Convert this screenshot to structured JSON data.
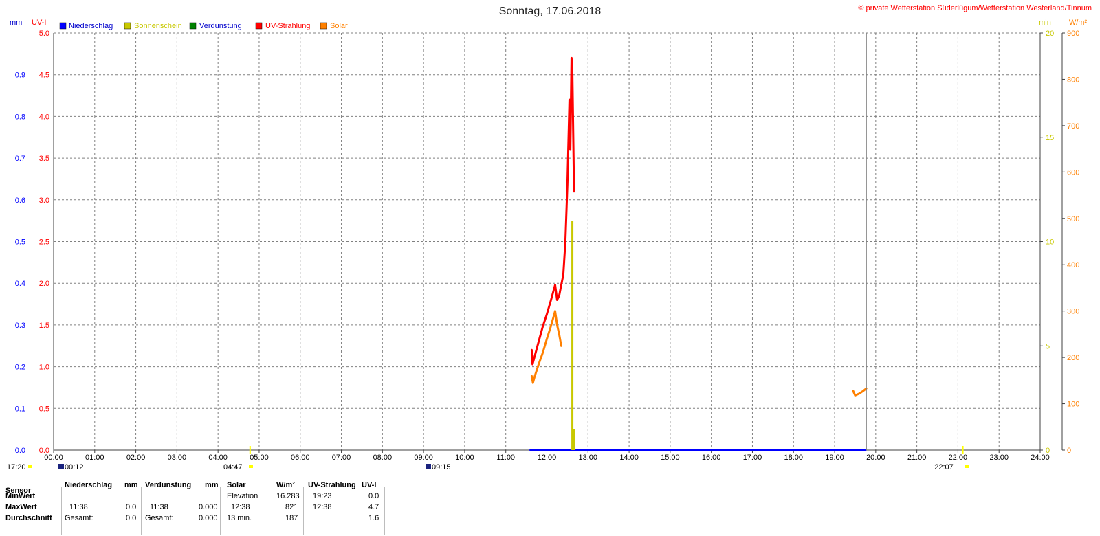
{
  "title": "Sonntag, 17.06.2018",
  "copyright": "© private Wetterstation Süderlügum/Wetterstation Westerland/Tinnum",
  "unit_labels": {
    "mm": "mm",
    "uvi": "UV-I",
    "min": "min",
    "wm2": "W/m²"
  },
  "colors": {
    "niederschlag": "#0000ff",
    "sonnenschein": "#c8c800",
    "verdunstung": "#008000",
    "uv": "#ff0000",
    "solar": "#ff8000",
    "grid": "#808080"
  },
  "sun_markers": {
    "left": [
      "17:20",
      "00:12",
      "04:47",
      "09:15"
    ],
    "right": "22:07"
  },
  "chart_data": {
    "type": "line",
    "legend_placement": "top-left",
    "grid": true,
    "x_axis": {
      "range_hours": [
        0,
        24
      ],
      "tick_labels": [
        "00:00",
        "01:00",
        "02:00",
        "03:00",
        "04:00",
        "05:00",
        "06:00",
        "07:00",
        "08:00",
        "09:00",
        "10:00",
        "11:00",
        "12:00",
        "13:00",
        "14:00",
        "15:00",
        "16:00",
        "17:00",
        "18:00",
        "19:00",
        "20:00",
        "21:00",
        "22:00",
        "23:00",
        "24:00"
      ]
    },
    "y_axes": {
      "mm": {
        "range": [
          0,
          1.0
        ],
        "tick_labels": [
          "0.0",
          "0.1",
          "0.2",
          "0.3",
          "0.4",
          "0.5",
          "0.6",
          "0.7",
          "0.8",
          "0.9",
          ""
        ]
      },
      "uv": {
        "range": [
          0,
          5.0
        ],
        "tick_labels": [
          "0.0",
          "0.5",
          "1.0",
          "1.5",
          "2.0",
          "2.5",
          "3.0",
          "3.5",
          "4.0",
          "4.5",
          "5.0"
        ]
      },
      "min": {
        "range": [
          0,
          20
        ],
        "tick_values": [
          0,
          5,
          10,
          15,
          20
        ],
        "tick_labels": [
          "0",
          "5",
          "10",
          "15",
          "20"
        ]
      },
      "wm2": {
        "range": [
          0,
          900
        ],
        "tick_values": [
          0,
          100,
          200,
          300,
          400,
          500,
          600,
          700,
          800,
          900
        ],
        "tick_labels": [
          "0",
          "100",
          "200",
          "300",
          "400",
          "500",
          "600",
          "700",
          "800",
          "900"
        ]
      }
    },
    "series": [
      {
        "name": "Niederschlag",
        "axis": "mm",
        "color": "#0000ff",
        "points": [
          [
            11.6,
            0
          ],
          [
            12.7,
            0
          ],
          [
            19.4,
            0
          ],
          [
            19.75,
            0
          ]
        ]
      },
      {
        "name": "Sonnenschein",
        "axis": "min",
        "color": "#c8c800",
        "bars": [
          [
            12.62,
            11.0
          ],
          [
            12.66,
            1.0
          ]
        ],
        "markers": [
          4.78,
          22.12
        ]
      },
      {
        "name": "Verdunstung",
        "axis": "mm",
        "color": "#008000",
        "points": []
      },
      {
        "name": "UV-Strahlung",
        "axis": "uv",
        "color": "#ff0000",
        "points": [
          [
            11.63,
            1.2
          ],
          [
            11.65,
            1.03
          ],
          [
            11.7,
            1.12
          ],
          [
            11.8,
            1.3
          ],
          [
            11.9,
            1.48
          ],
          [
            12.0,
            1.63
          ],
          [
            12.1,
            1.8
          ],
          [
            12.2,
            1.98
          ],
          [
            12.25,
            1.8
          ],
          [
            12.3,
            1.85
          ],
          [
            12.35,
            1.98
          ],
          [
            12.4,
            2.1
          ],
          [
            12.45,
            2.5
          ],
          [
            12.5,
            3.2
          ],
          [
            12.55,
            4.2
          ],
          [
            12.57,
            3.6
          ],
          [
            12.6,
            4.7
          ],
          [
            12.62,
            4.5
          ],
          [
            12.64,
            3.8
          ],
          [
            12.66,
            3.1
          ]
        ]
      },
      {
        "name": "Solar",
        "axis": "wm2",
        "color": "#ff8000",
        "points": [
          [
            11.63,
            160
          ],
          [
            11.66,
            145
          ],
          [
            11.7,
            158
          ],
          [
            11.8,
            185
          ],
          [
            11.9,
            210
          ],
          [
            12.0,
            240
          ],
          [
            12.1,
            268
          ],
          [
            12.2,
            300
          ],
          [
            12.25,
            270
          ],
          [
            12.3,
            250
          ],
          [
            12.35,
            225
          ]
        ],
        "points2": [
          [
            19.45,
            128
          ],
          [
            19.5,
            118
          ],
          [
            19.6,
            122
          ],
          [
            19.7,
            128
          ],
          [
            19.77,
            133
          ]
        ]
      }
    ],
    "markers": {
      "sunrise_hour": 4.78,
      "sunset_hour": 22.12,
      "vertical_line_hour": 19.77
    }
  },
  "stats": {
    "headers": {
      "sensor": "Sensor",
      "niederschlag": "Niederschlag",
      "niederschlag_unit": "mm",
      "verdunstung": "Verdunstung",
      "verdunstung_unit": "mm",
      "solar": "Solar",
      "solar_unit": "W/m²",
      "uv": "UV-Strahlung",
      "uv_unit": "UV-I"
    },
    "rows": [
      {
        "label": "MinWert",
        "n_time": "",
        "n_val": "",
        "v_time": "",
        "v_val": "",
        "s_time": "Elevation",
        "s_val": "16.283",
        "u_time": "19:23",
        "u_val": "0.0"
      },
      {
        "label": "MaxWert",
        "n_time": "11:38",
        "n_val": "0.0",
        "v_time": "11:38",
        "v_val": "0.000",
        "s_time": "12:38",
        "s_val": "821",
        "u_time": "12:38",
        "u_val": "4.7"
      },
      {
        "label": "Durchschnitt",
        "n_time": "Gesamt:",
        "n_val": "0.0",
        "v_time": "Gesamt:",
        "v_val": "0.000",
        "s_time": "13 min.",
        "s_val": "187",
        "u_time": "",
        "u_val": "1.6"
      }
    ]
  }
}
